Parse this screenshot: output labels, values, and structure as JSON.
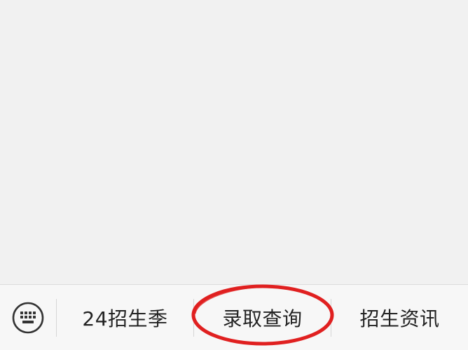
{
  "menu": {
    "keyboard_icon": "keyboard-icon",
    "items": [
      {
        "label": "24招生季"
      },
      {
        "label": "录取查询"
      },
      {
        "label": "招生资讯"
      }
    ]
  },
  "colors": {
    "background": "#f1f1f1",
    "menu_bar": "#f7f7f7",
    "text": "#222222",
    "icon": "#333333",
    "annotation": "#e02020"
  }
}
